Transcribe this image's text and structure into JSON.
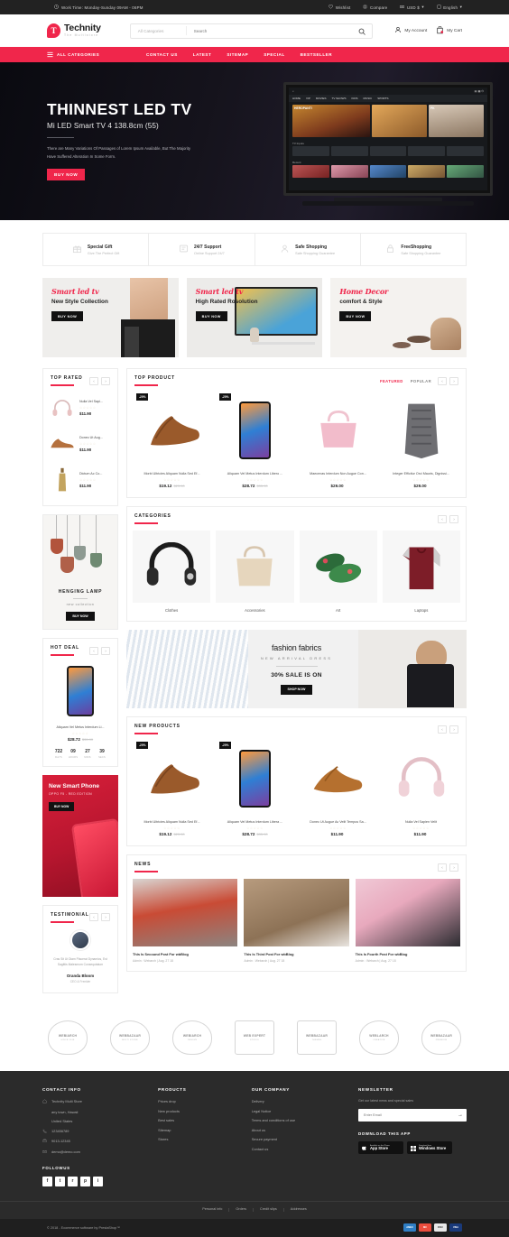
{
  "topbar": {
    "work_time": "Work Time: Monday-Sunday 09AM - 06PM",
    "clock_icon": "clock-icon",
    "wishlist": "Wishlist",
    "compare": "Compare",
    "currency": "USD $",
    "language": "English"
  },
  "header": {
    "logo_name": "Technity",
    "logo_sub": "The Multistore",
    "search_category": "All Categories",
    "search_placeholder": "Search",
    "my_account": "My Account",
    "my_cart": "My Cart"
  },
  "nav": {
    "all_categories": "ALL CATEGORIES",
    "items": [
      "CONTACT US",
      "LATEST",
      "SITEMAP",
      "SPECIAL",
      "BESTSELLER"
    ]
  },
  "hero": {
    "title": "THINNEST LED TV",
    "subtitle": "Mi LED Smart TV 4 138.8cm (55)",
    "paragraph": "There are Many Variations Of Passages of Lorem Ipsum Available, But The Majority Have Suffered Alteration In Some Form.",
    "button": "BUY NOW",
    "tv": {
      "tabs": [
        "HOME",
        "VIP",
        "MOVIES",
        "TV SHOWS",
        "KIDS",
        "MUSIC",
        "SPORTS"
      ],
      "card_labels": [
        "HEROPANTI",
        "",
        "PK"
      ],
      "row_title": "TV Inputs",
      "recent_title": "Recent"
    }
  },
  "services": [
    {
      "icon": "gift-icon",
      "title": "Special Gift",
      "subtitle": "Give The Perfect Gift"
    },
    {
      "icon": "support-icon",
      "title": "24/7 Support",
      "subtitle": "Online Support 24/7"
    },
    {
      "icon": "shield-user-icon",
      "title": "Safe Shopping",
      "subtitle": "Safe Shopping Guarantee"
    },
    {
      "icon": "lock-icon",
      "title": "FreeShopping",
      "subtitle": "Safe Shopping Guarantee"
    }
  ],
  "promos": [
    {
      "script": "Smart led tv",
      "heading": "New Style Collection",
      "button": "BUY NOW"
    },
    {
      "script": "Smart led tv",
      "heading": "High Rated Rosolution",
      "button": "BUY NOW"
    },
    {
      "script": "Home Decor",
      "heading": "comfort & Style",
      "button": "BUY NOW"
    }
  ],
  "top_rated": {
    "title": "TOP RATED",
    "items": [
      {
        "name": "Nulla Vel Sapi...",
        "price": "$11.90",
        "stars": "☆☆☆☆☆",
        "thumb": "headphones-thumb"
      },
      {
        "name": "Donec Ut Aug...",
        "price": "$11.90",
        "stars": "☆☆☆☆☆",
        "thumb": "brown-shoe-thumb"
      },
      {
        "name": "Dictum Ac Co...",
        "price": "$11.90",
        "stars": "☆☆☆☆☆",
        "thumb": "bottle-thumb"
      }
    ]
  },
  "top_product": {
    "title": "TOP PRODUCT",
    "tabs": [
      {
        "label": "FEATURED",
        "active": true
      },
      {
        "label": "POPULAR",
        "active": false
      }
    ],
    "items": [
      {
        "name": "Morbi Ultricies Aliquam Nulla Sed Ef...",
        "price": "$19.12",
        "old_price": "$23.90",
        "badge": "-20%",
        "stars": "☆☆☆☆☆",
        "image": "brown-shoes"
      },
      {
        "name": "Aliquam Vel Metus Interdum Libero ...",
        "price": "$28.72",
        "old_price": "$35.90",
        "badge": "-20%",
        "stars": "☆☆☆☆☆",
        "image": "smartphone"
      },
      {
        "name": "Maecenas Interdum Non Augue Con...",
        "price": "$29.00",
        "old_price": "",
        "badge": "",
        "stars": "☆☆☆☆☆",
        "image": "pink-handbag"
      },
      {
        "name": "Integer Efficitur Orci Mauris, Dignissi...",
        "price": "$29.00",
        "old_price": "",
        "badge": "",
        "stars": "☆☆☆☆☆",
        "image": "grey-scarf"
      }
    ]
  },
  "categories": {
    "title": "CATEGORIES",
    "items": [
      {
        "name": "Clothes",
        "image": "headphones"
      },
      {
        "name": "Accessories",
        "image": "beige-handbag"
      },
      {
        "name": "Art",
        "image": "floral-flats"
      },
      {
        "name": "Laptops",
        "image": "maroon-hoodie"
      }
    ]
  },
  "lamp_banner": {
    "title": "HENGING LAMP",
    "subtitle": "new collection",
    "button": "BUY NOW"
  },
  "hot_deal": {
    "title": "HOT DEAL",
    "product_name": "Aliquam Vel Metus Interdum Li...",
    "price": "$28.72",
    "old_price": "$35.90",
    "stars": "☆☆☆☆☆",
    "countdown": [
      {
        "num": "722",
        "label": "DAYS"
      },
      {
        "num": "09",
        "label": "HOURS"
      },
      {
        "num": "27",
        "label": "MINS"
      },
      {
        "num": "39",
        "label": "SECS"
      }
    ]
  },
  "phone_banner": {
    "line1": "New Smart Phone",
    "line2": "OPPO F5 - RED EDITION",
    "button": "BUY NOW"
  },
  "fashion_banner": {
    "title": "fashion fabrics",
    "subtitle": "NEW ARRIVAL DRESS",
    "sale": "30% SALE IS ON",
    "button": "SHOP NOW"
  },
  "new_products": {
    "title": "NEW PRODUCTS",
    "items": [
      {
        "name": "Morbi Ultricies Aliquam Nulla Sed Ef...",
        "price": "$19.12",
        "old_price": "$23.90",
        "badge": "-20%",
        "stars": "☆☆☆☆☆",
        "image": "brown-shoes"
      },
      {
        "name": "Aliquam Vel Metus Interdum Libera ...",
        "price": "$28.72",
        "old_price": "$35.90",
        "badge": "-20%",
        "stars": "☆☆☆☆☆",
        "image": "smartphone"
      },
      {
        "name": "Donec Ut Augue Ac Velit Tempus Sa...",
        "price": "$11.90",
        "old_price": "",
        "badge": "",
        "stars": "☆☆☆☆☆",
        "image": "tan-shoe"
      },
      {
        "name": "Nulla Vel Sapien Velit",
        "price": "$11.90",
        "old_price": "",
        "badge": "",
        "stars": "☆☆☆☆☆",
        "image": "headphones"
      }
    ]
  },
  "news": {
    "title": "NEWS",
    "items": [
      {
        "title": "This Is Secound Post For wbBlog",
        "meta": "Admin : Webarch | Aug. 27 18",
        "image": "woman-red-jacket"
      },
      {
        "title": "This Is Third Post For wbBlog",
        "meta": "Admin : Webarch | Aug. 27 18",
        "image": "camera-headphones"
      },
      {
        "title": "This Is Fourth Post For wbBlog",
        "meta": "Admin : Webarch | Aug. 27 18",
        "image": "woman-pink"
      }
    ]
  },
  "testimonial": {
    "title": "TESTIMONIAL",
    "text": "Cras Sit Ut Diam Placerat Dynamics, Est Sagittis Malesmom Consequtatum",
    "name": "Oranda Bloom",
    "role": "CEO & Frenkler"
  },
  "brands": [
    {
      "name": "WEBIARCH",
      "sub": "SINCE 2018"
    },
    {
      "name": "WEBBAZAAR",
      "sub": "MULTI STORE"
    },
    {
      "name": "WEBIARCH",
      "sub": "DESIGN"
    },
    {
      "name": "WEB EXPERT",
      "sub": "STUDIO"
    },
    {
      "name": "WEBBAZAAR",
      "sub": "THEMES"
    },
    {
      "name": "WEBLARCH",
      "sub": "CREATIVE"
    },
    {
      "name": "WEBBAZAAR",
      "sub": "PREMIUM"
    }
  ],
  "footer": {
    "contact": {
      "heading": "CONTACT INFO",
      "address_lines": [
        "Technity Multi Store",
        "any town, Hawaii",
        "United States"
      ],
      "phone": "123456789",
      "fax": "9013-12345",
      "email": "demo@demo.com",
      "follow_heading": "FOLLOWUS",
      "socials": [
        "f",
        "t",
        "r",
        "p",
        "i"
      ]
    },
    "products": {
      "heading": "PRODUCTS",
      "items": [
        "Prices drop",
        "New products",
        "Best sales",
        "Sitemap",
        "Stores"
      ]
    },
    "company": {
      "heading": "OUR COMPANY",
      "items": [
        "Delivery",
        "Legal Notice",
        "Terms and conditions of use",
        "About us",
        "Secure payment",
        "Contact us"
      ]
    },
    "newsletter": {
      "heading": "NEWSLETTER",
      "subtitle": "Get our latest news and special sales",
      "placeholder": "Enter Email",
      "download_heading": "DOWNLOAD THIS APP",
      "stores": [
        {
          "line1": "Available on the iPhone",
          "line2": "App Store"
        },
        {
          "line1": "Download from",
          "line2": "Windows Store"
        }
      ]
    },
    "links": [
      "Personal info",
      "Orders",
      "Credit slips",
      "Addresses"
    ],
    "copyright": "© 2018 - Ecommerce software by PrestaShop™",
    "cards": [
      "AMEX",
      "MC",
      "DISC",
      "VISA"
    ]
  },
  "colors": {
    "accent": "#f0264b",
    "dark": "#2b2b2b",
    "star": "#f5c14b"
  }
}
